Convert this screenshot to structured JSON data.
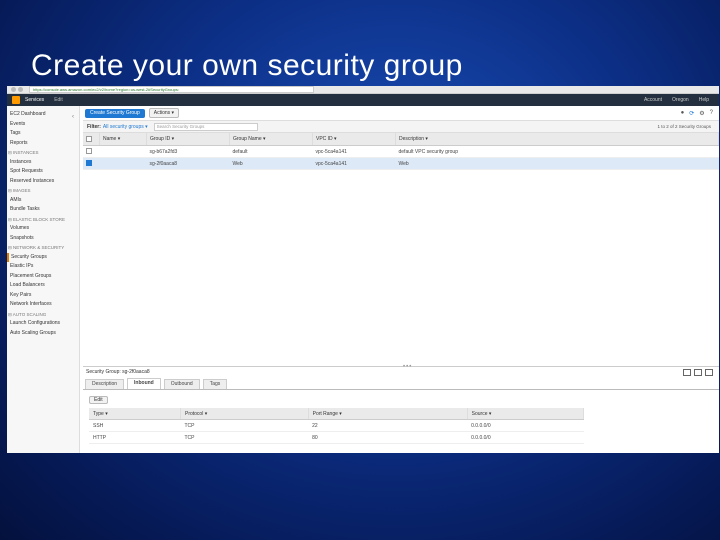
{
  "slide": {
    "title": "Create your own security group"
  },
  "browser": {
    "url": "https://console.aws.amazon.com/ec2/v2/home?region=us-west-2#SecurityGroups:"
  },
  "aws_nav": {
    "services": "Services",
    "edit": "Edit",
    "account": "Account",
    "region": "Oregon",
    "help": "Help"
  },
  "sidebar": {
    "items": [
      {
        "label": "EC2 Dashboard",
        "type": "item"
      },
      {
        "label": "Events",
        "type": "item"
      },
      {
        "label": "Tags",
        "type": "item"
      },
      {
        "label": "Reports",
        "type": "item"
      },
      {
        "label": "INSTANCES",
        "type": "section"
      },
      {
        "label": "Instances",
        "type": "item"
      },
      {
        "label": "Spot Requests",
        "type": "item"
      },
      {
        "label": "Reserved Instances",
        "type": "item"
      },
      {
        "label": "IMAGES",
        "type": "section"
      },
      {
        "label": "AMIs",
        "type": "item"
      },
      {
        "label": "Bundle Tasks",
        "type": "item"
      },
      {
        "label": "ELASTIC BLOCK STORE",
        "type": "section"
      },
      {
        "label": "Volumes",
        "type": "item"
      },
      {
        "label": "Snapshots",
        "type": "item"
      },
      {
        "label": "NETWORK & SECURITY",
        "type": "section"
      },
      {
        "label": "Security Groups",
        "type": "active"
      },
      {
        "label": "Elastic IPs",
        "type": "item"
      },
      {
        "label": "Placement Groups",
        "type": "item"
      },
      {
        "label": "Load Balancers",
        "type": "item"
      },
      {
        "label": "Key Pairs",
        "type": "item"
      },
      {
        "label": "Network Interfaces",
        "type": "item"
      },
      {
        "label": "AUTO SCALING",
        "type": "section"
      },
      {
        "label": "Launch Configurations",
        "type": "item"
      },
      {
        "label": "Auto Scaling Groups",
        "type": "item"
      }
    ]
  },
  "toolbar": {
    "create_label": "Create Security Group",
    "actions_label": "Actions"
  },
  "filter": {
    "label": "Filter:",
    "selected": "All security groups",
    "search_placeholder": "Search Security Groups",
    "pager": "1 to 2 of 2 Security Groups"
  },
  "groups_table": {
    "headers": [
      "Name",
      "Group ID",
      "Group Name",
      "VPC ID",
      "Description"
    ],
    "rows": [
      {
        "name": "",
        "group_id": "sg-b67a2fd3",
        "group_name": "default",
        "vpc_id": "vpc-5ca4a141",
        "description": "default VPC security group",
        "selected": false
      },
      {
        "name": "",
        "group_id": "sg-2f0aaca8",
        "group_name": "Web",
        "vpc_id": "vpc-5ca4a141",
        "description": "Web",
        "selected": true
      }
    ]
  },
  "details": {
    "title": "Security Group: sg-2f0aaca8",
    "tabs": [
      "Description",
      "Inbound",
      "Outbound",
      "Tags"
    ],
    "active_tab": "Inbound",
    "edit_label": "Edit"
  },
  "rules_table": {
    "headers": [
      "Type",
      "Protocol",
      "Port Range",
      "Source"
    ],
    "rows": [
      [
        "SSH",
        "TCP",
        "22",
        "0.0.0.0/0"
      ],
      [
        "HTTP",
        "TCP",
        "80",
        "0.0.0.0/0"
      ]
    ]
  },
  "colors": {
    "slide_bg": "#0c2f86",
    "aws_nav": "#232f3e",
    "primary_button": "#1f78d1",
    "aws_logo": "#ff9900"
  }
}
